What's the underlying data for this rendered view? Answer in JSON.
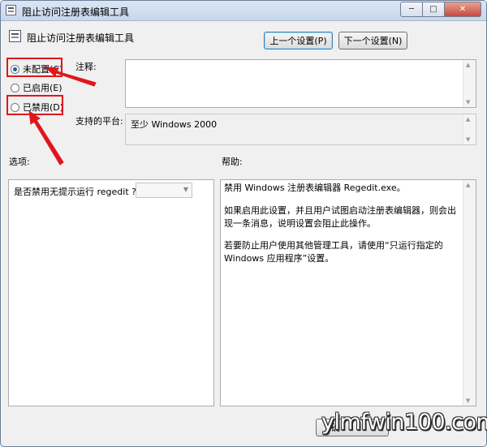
{
  "window": {
    "title": "阻止访问注册表编辑工具",
    "minimize": "─",
    "maximize": "□",
    "close": "✕"
  },
  "header": {
    "title": "阻止访问注册表编辑工具",
    "prev_button": "上一个设置(P)",
    "next_button": "下一个设置(N)"
  },
  "state": {
    "options": [
      {
        "label": "未配置(C)",
        "selected": true
      },
      {
        "label": "已启用(E)",
        "selected": false
      },
      {
        "label": "已禁用(D)",
        "selected": false
      }
    ]
  },
  "comment": {
    "label": "注释:",
    "value": ""
  },
  "platform": {
    "label": "支持的平台:",
    "value": "至少 Windows 2000"
  },
  "options_panel": {
    "label": "选项:",
    "question": "是否禁用无提示运行 regedit ?",
    "combo_value": ""
  },
  "help_panel": {
    "label": "帮助:",
    "paragraphs": [
      "禁用 Windows 注册表编辑器 Regedit.exe。",
      "如果启用此设置，并且用户试图启动注册表编辑器，则会出现一条消息，说明设置会阻止此操作。",
      "若要防止用户使用其他管理工具，请使用“只运行指定的 Windows 应用程序”设置。"
    ]
  },
  "footer": {
    "ok_button": "确"
  },
  "watermark": "ylmfwin100.com",
  "colors": {
    "annotation": "#e0161c",
    "selection": "#1e5aa8"
  }
}
